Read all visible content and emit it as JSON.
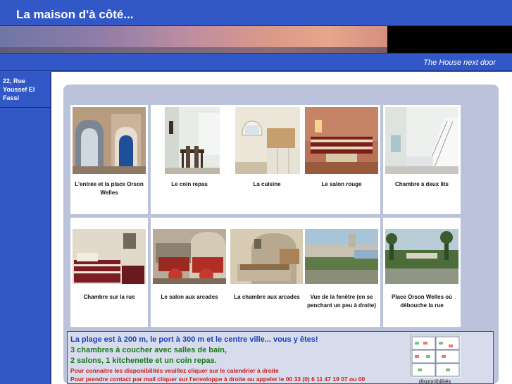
{
  "header": {
    "title": "La maison d'à côté..."
  },
  "subbar": {
    "tagline": "The House next door"
  },
  "sidebar": {
    "address": "22, Rue Youssef El Fassi"
  },
  "gallery": {
    "row1": [
      {
        "caption": "L'entrée et la place Orson Welles"
      },
      {
        "caption": "Le coin repas"
      },
      {
        "caption": "La cuisine"
      },
      {
        "caption": "Le salon rouge"
      },
      {
        "caption": "Chambre à deux lits"
      }
    ],
    "row2": [
      {
        "caption": "Chambre sur la rue"
      },
      {
        "caption": "Le salon aux arcades"
      },
      {
        "caption": "La chambre aux arcades"
      },
      {
        "caption": "Vue de la fenêtre (en se penchant un peu à droite)"
      },
      {
        "caption": "Place Orson Welles où débouche la rue"
      }
    ]
  },
  "info": {
    "line1": "La plage est à 200 m, le port à 300 m et le centre ville... vous y êtes!",
    "line2": "3 chambres à coucher avec salles de bain,",
    "line3": "2 salons, 1 kitchenette et un coin repas.",
    "line4": "Pour connaitre les disponibilités  veuillez cliquer sur le calendrier à droite",
    "line5": "Pour prendre contact par mail cliquer sur l'enveloppe à droite ou appeler le 00 33 (0) 6 11 47 19 07 ou 00",
    "calendar_label": "disponibilités"
  }
}
